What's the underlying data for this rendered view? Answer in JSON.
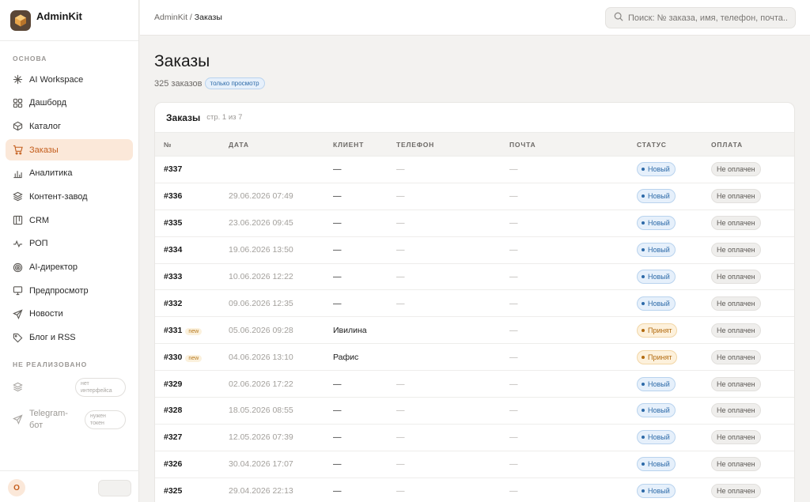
{
  "app": {
    "name": "AdminKit"
  },
  "breadcrumb": {
    "root": "AdminKit",
    "separator": " / ",
    "current": "Заказы"
  },
  "search": {
    "placeholder": "Поиск: № заказа, имя, телефон, почта..",
    "value": ""
  },
  "sidebar": {
    "section_main": "ОСНОВА",
    "items": [
      {
        "label": "AI Workspace",
        "icon": "sparkle-icon"
      },
      {
        "label": "Дашборд",
        "icon": "grid-icon"
      },
      {
        "label": "Каталог",
        "icon": "box-icon"
      },
      {
        "label": "Заказы",
        "icon": "cart-icon",
        "active": true
      },
      {
        "label": "Аналитика",
        "icon": "bar-chart-icon"
      },
      {
        "label": "Контент-завод",
        "icon": "layers-icon"
      },
      {
        "label": "CRM",
        "icon": "kanban-icon"
      },
      {
        "label": "РОП",
        "icon": "pulse-icon"
      },
      {
        "label": "AI-директор",
        "icon": "target-icon"
      },
      {
        "label": "Предпросмотр",
        "icon": "monitor-icon"
      },
      {
        "label": "Новости",
        "icon": "send-icon"
      },
      {
        "label": "Блог и RSS",
        "icon": "tag-icon"
      }
    ],
    "section_unimpl": "НЕ РЕАЛИЗОВАНО",
    "unimpl_items": [
      {
        "label": "",
        "badge": "нет интерфейса",
        "icon": "layers-icon"
      },
      {
        "label": "Telegram-бот",
        "badge": "нужен токен",
        "icon": "send-icon"
      }
    ],
    "avatar_initial": "O"
  },
  "page": {
    "title": "Заказы",
    "count_text": "325 заказов",
    "mode_badge": "только просмотр"
  },
  "orders_card": {
    "title": "Заказы",
    "pagination": "стр. 1 из 7",
    "columns": [
      "№",
      "ДАТА",
      "КЛИЕНТ",
      "ТЕЛЕФОН",
      "ПОЧТА",
      "СТАТУС",
      "ОПЛАТА"
    ],
    "rows": [
      {
        "num": "#337",
        "new": "",
        "date": "",
        "client": "—",
        "phone": "—",
        "email": "—",
        "status": "Новый",
        "payment": "Не оплачен"
      },
      {
        "num": "#336",
        "new": "",
        "date": "29.06.2026 07:49",
        "client": "—",
        "phone": "—",
        "email": "—",
        "status": "Новый",
        "payment": "Не оплачен"
      },
      {
        "num": "#335",
        "new": "",
        "date": "23.06.2026 09:45",
        "client": "—",
        "phone": "—",
        "email": "—",
        "status": "Новый",
        "payment": "Не оплачен"
      },
      {
        "num": "#334",
        "new": "",
        "date": "19.06.2026 13:50",
        "client": "—",
        "phone": "—",
        "email": "—",
        "status": "Новый",
        "payment": "Не оплачен"
      },
      {
        "num": "#333",
        "new": "",
        "date": "10.06.2026 12:22",
        "client": "—",
        "phone": "—",
        "email": "—",
        "status": "Новый",
        "payment": "Не оплачен"
      },
      {
        "num": "#332",
        "new": "",
        "date": "09.06.2026 12:35",
        "client": "—",
        "phone": "—",
        "email": "—",
        "status": "Новый",
        "payment": "Не оплачен"
      },
      {
        "num": "#331",
        "new": "new",
        "date": "05.06.2026 09:28",
        "client": "Ивилина",
        "phone": "",
        "email": "—",
        "status": "Принят",
        "payment": "Не оплачен"
      },
      {
        "num": "#330",
        "new": "new",
        "date": "04.06.2026 13:10",
        "client": "Рафис",
        "phone": "",
        "email": "—",
        "status": "Принят",
        "payment": "Не оплачен"
      },
      {
        "num": "#329",
        "new": "",
        "date": "02.06.2026 17:22",
        "client": "—",
        "phone": "—",
        "email": "—",
        "status": "Новый",
        "payment": "Не оплачен"
      },
      {
        "num": "#328",
        "new": "",
        "date": "18.05.2026 08:55",
        "client": "—",
        "phone": "—",
        "email": "—",
        "status": "Новый",
        "payment": "Не оплачен"
      },
      {
        "num": "#327",
        "new": "",
        "date": "12.05.2026 07:39",
        "client": "—",
        "phone": "—",
        "email": "—",
        "status": "Новый",
        "payment": "Не оплачен"
      },
      {
        "num": "#326",
        "new": "",
        "date": "30.04.2026 17:07",
        "client": "—",
        "phone": "—",
        "email": "—",
        "status": "Новый",
        "payment": "Не оплачен"
      },
      {
        "num": "#325",
        "new": "",
        "date": "29.04.2026 22:13",
        "client": "—",
        "phone": "—",
        "email": "—",
        "status": "Новый",
        "payment": "Не оплачен"
      }
    ]
  },
  "colors": {
    "accent": "#c45e1d",
    "accent_bg": "#fbe8d9",
    "status_new_text": "#2d6aa8",
    "status_new_bg": "#e6f0fb",
    "status_new_border": "#b9d3ee",
    "status_accepted_text": "#b26a0e",
    "status_accepted_bg": "#fdf1dc",
    "status_accepted_border": "#f2d6a6"
  }
}
